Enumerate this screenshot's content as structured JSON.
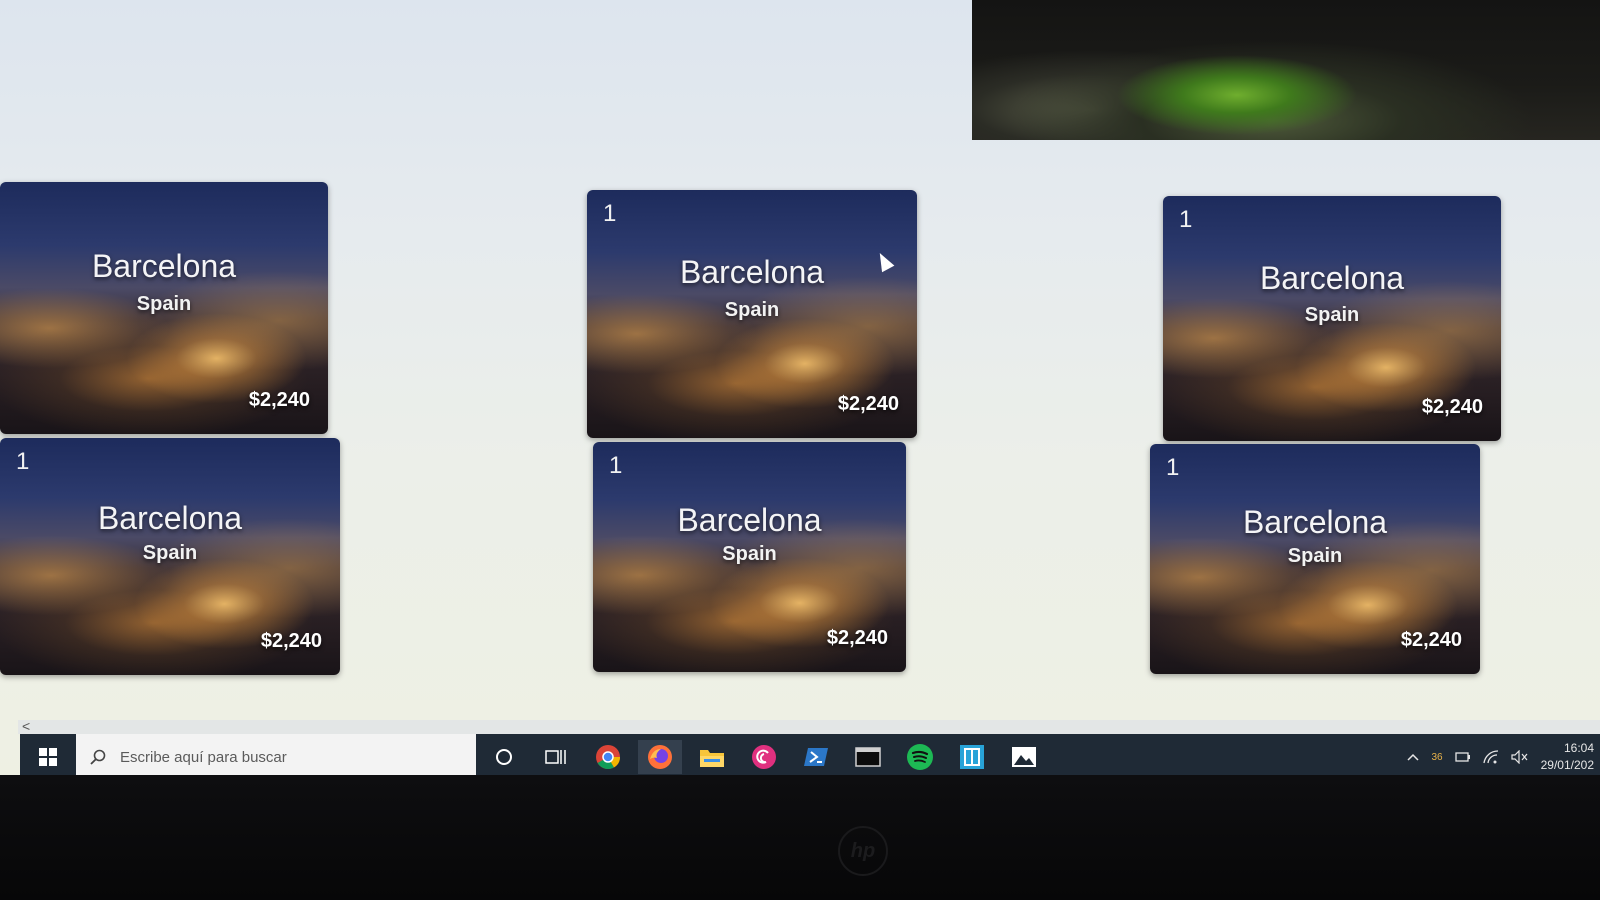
{
  "cards": [
    {
      "count": "",
      "city": "Barcelona",
      "country": "Spain",
      "price": "$2,240"
    },
    {
      "count": "1",
      "city": "Barcelona",
      "country": "Spain",
      "price": "$2,240"
    },
    {
      "count": "1",
      "city": "Barcelona",
      "country": "Spain",
      "price": "$2,240"
    },
    {
      "count": "1",
      "city": "Barcelona",
      "country": "Spain",
      "price": "$2,240"
    },
    {
      "count": "1",
      "city": "Barcelona",
      "country": "Spain",
      "price": "$2,240"
    },
    {
      "count": "1",
      "city": "Barcelona",
      "country": "Spain",
      "price": "$2,240"
    }
  ],
  "taskbar": {
    "search_placeholder": "Escribe aquí para buscar",
    "apps": [
      "cortana-icon",
      "task-view-icon",
      "chrome-icon",
      "firefox-icon",
      "file-explorer-icon",
      "debian-icon",
      "powershell-icon",
      "terminal-icon",
      "spotify-icon",
      "sandbox-icon",
      "photos-icon"
    ],
    "tray": {
      "temperature": "36",
      "time": "16:04",
      "date": "29/01/202"
    }
  },
  "scrollbar": {
    "left_arrow": "<"
  },
  "colors": {
    "taskbar_bg": "#1f2a36",
    "page_bg": "#e6ebee",
    "hero_green": "#6fae2e"
  }
}
